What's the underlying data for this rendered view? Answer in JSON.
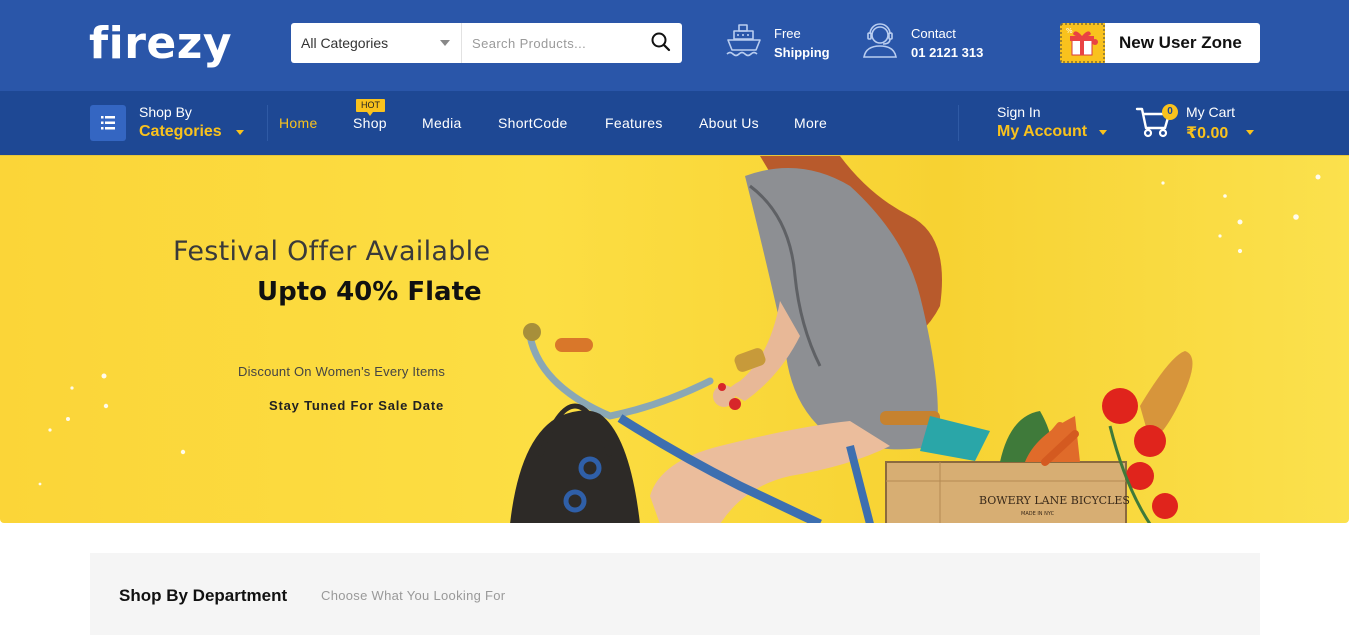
{
  "header": {
    "logo": "firezy",
    "search": {
      "category": "All Categories",
      "placeholder": "Search Products...",
      "value": ""
    },
    "shipping": {
      "line1": "Free",
      "line2": "Shipping",
      "icon": "ship-icon"
    },
    "contact": {
      "line1": "Contact",
      "line2": "01 2121 313",
      "icon": "support-agent-icon"
    },
    "new_user": {
      "label": "New User Zone",
      "icon": "gift-icon"
    }
  },
  "nav": {
    "shop_by": "Shop By",
    "categories": "Categories",
    "menu": [
      {
        "label": "Home",
        "active": true
      },
      {
        "label": "Shop",
        "badge": "HOT"
      },
      {
        "label": "Media"
      },
      {
        "label": "ShortCode"
      },
      {
        "label": "Features"
      },
      {
        "label": "About Us"
      },
      {
        "label": "More"
      }
    ],
    "account": {
      "line1": "Sign In",
      "line2": "My Account"
    },
    "cart": {
      "count": "0",
      "line1": "My Cart",
      "total": "₹0.00"
    }
  },
  "hero": {
    "title": "Festival Offer Available",
    "subtitle": "Upto 40% Flate",
    "description": "Discount On Women's Every Items",
    "cta": "Stay Tuned For Sale Date",
    "crate_text": "BOWERY LANE BICYCLES",
    "crate_subtext": "MADE IN NYC"
  },
  "department": {
    "title": "Shop By Department",
    "subtitle": "Choose What You Looking For"
  },
  "colors": {
    "header_bg": "#2a56a9",
    "nav_bg": "#1e4894",
    "accent": "#f9c21d",
    "hero_bg": "#fcd83c"
  }
}
